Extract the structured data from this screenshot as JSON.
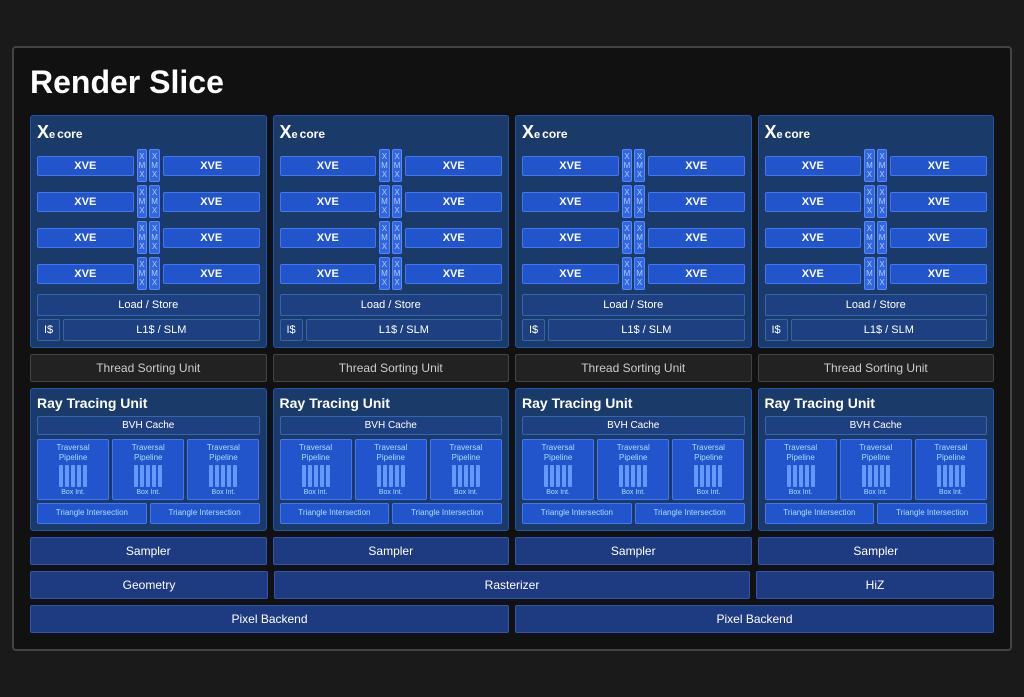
{
  "title": "Render Slice",
  "xe_cores": [
    {
      "label": "Xe",
      "sub": "e",
      "suffix": "core"
    },
    {
      "label": "Xe",
      "sub": "e",
      "suffix": "core"
    },
    {
      "label": "Xe",
      "sub": "e",
      "suffix": "core"
    },
    {
      "label": "Xe",
      "sub": "e",
      "suffix": "core"
    }
  ],
  "xve_label": "XVE",
  "xmx_labels": [
    "X\nM\nX",
    "X\nM\nX"
  ],
  "load_store": "Load / Store",
  "icache": "I$",
  "l1slm": "L1$ / SLM",
  "tsu": "Thread Sorting Unit",
  "rt_label": "Ray Tracing Unit",
  "bvh_cache": "BVH Cache",
  "traversal_pipeline": "Traversal\nPipeline",
  "box_int": "Box Int.",
  "triangle_intersection": "Triangle\nIntersection",
  "sampler": "Sampler",
  "geometry": "Geometry",
  "rasterizer": "Rasterizer",
  "hiz": "HiZ",
  "pixel_backend": "Pixel Backend"
}
